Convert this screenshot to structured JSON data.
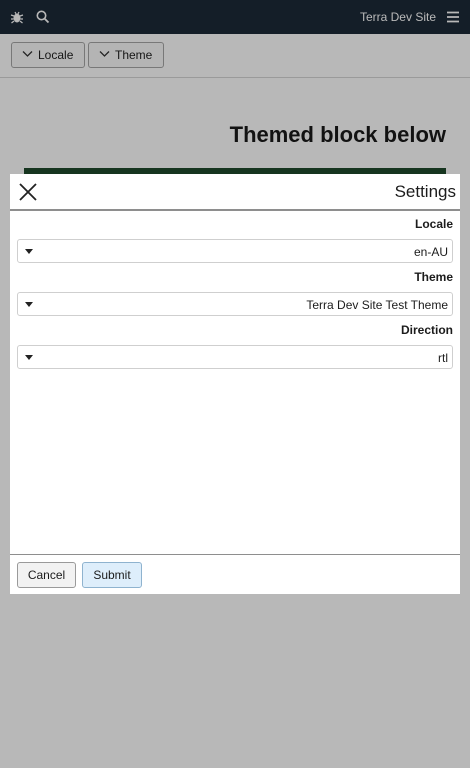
{
  "header": {
    "site_title": "Terra Dev Site",
    "icons": [
      "bug-icon",
      "search-icon",
      "menu-icon"
    ]
  },
  "toolbar": {
    "locale_label": "Locale",
    "theme_label": "Theme"
  },
  "page": {
    "heading": "Themed block below"
  },
  "modal": {
    "title": "Settings",
    "fields": [
      {
        "label": "Locale",
        "value": "en-AU"
      },
      {
        "label": "Theme",
        "value": "Terra Dev Site Test Theme"
      },
      {
        "label": "Direction",
        "value": "rtl"
      }
    ],
    "cancel_label": "Cancel",
    "submit_label": "Submit"
  },
  "colors": {
    "topbar": "#1c2a38",
    "themed_block": "#1f4a2c",
    "submit_bg": "#deeefb"
  }
}
